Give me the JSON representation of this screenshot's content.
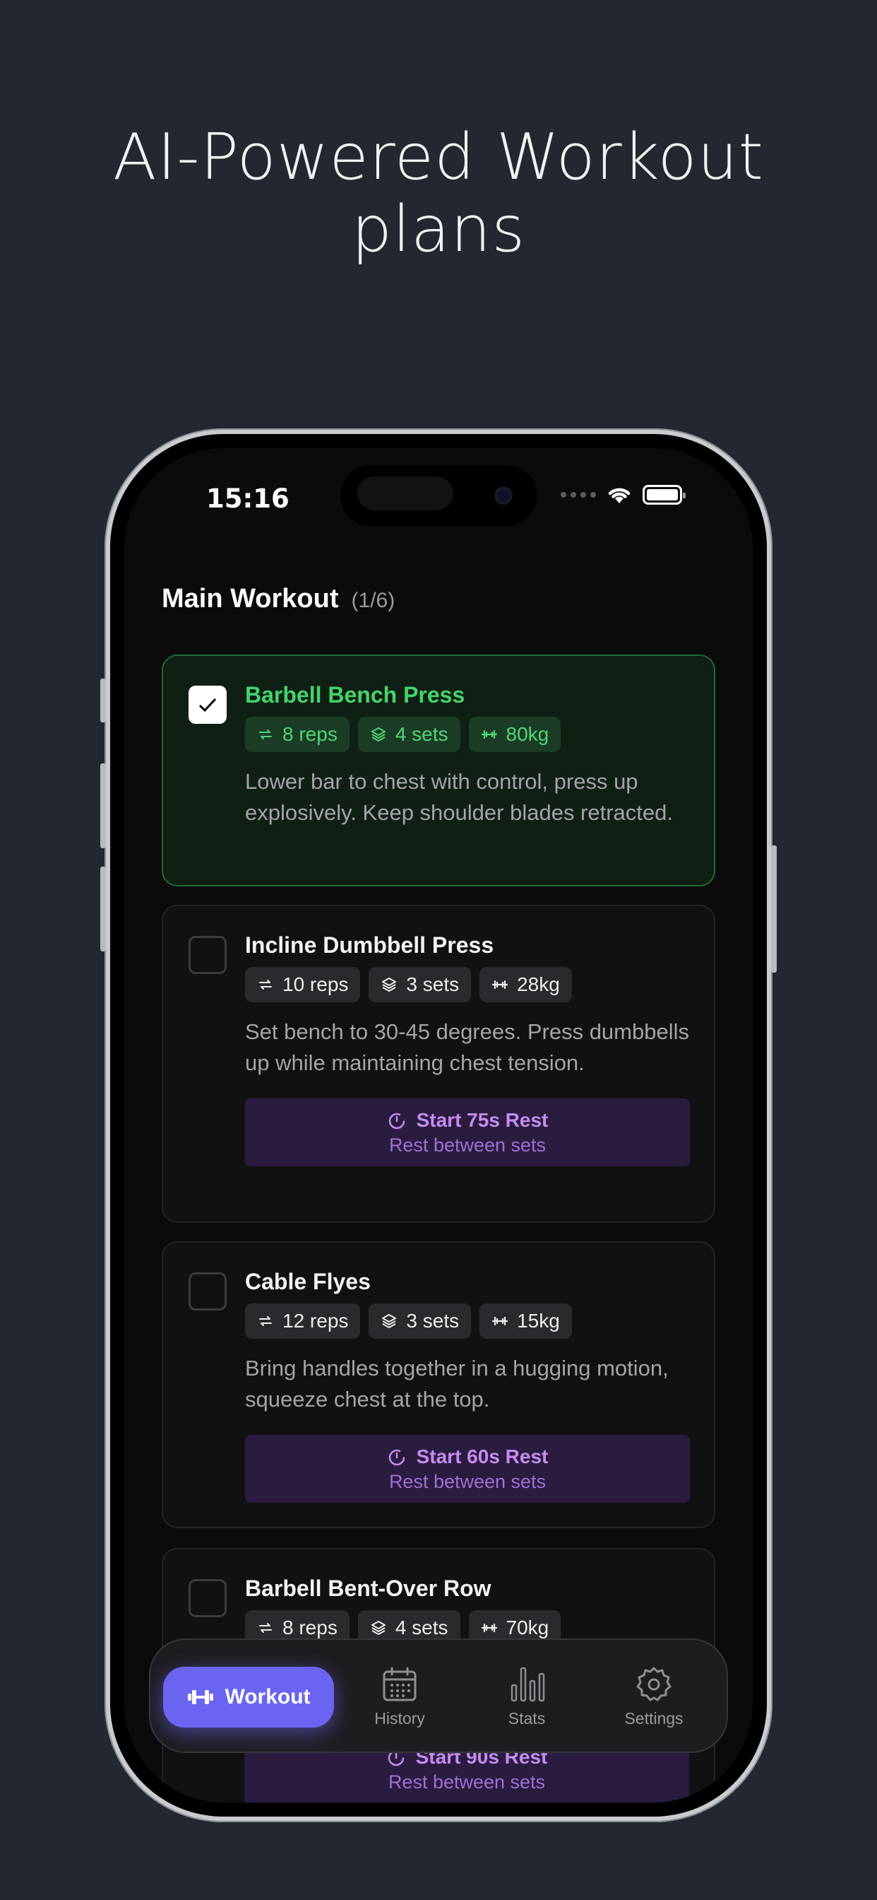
{
  "headline": {
    "line1": "AI-Powered Workout",
    "line2": "plans"
  },
  "status_bar": {
    "time": "15:16"
  },
  "section": {
    "title": "Main Workout",
    "count": "(1/6)"
  },
  "exercises": [
    {
      "name": "Barbell Bench Press",
      "completed": true,
      "reps": "8 reps",
      "sets": "4 sets",
      "weight": "80kg",
      "description": "Lower bar to chest with control, press up explosively. Keep shoulder blades retracted."
    },
    {
      "name": "Incline Dumbbell Press",
      "completed": false,
      "reps": "10 reps",
      "sets": "3 sets",
      "weight": "28kg",
      "description": "Set bench to 30-45 degrees. Press dumbbells up while maintaining chest tension.",
      "rest_button": {
        "label": "Start 75s Rest",
        "sublabel": "Rest between sets"
      }
    },
    {
      "name": "Cable Flyes",
      "completed": false,
      "reps": "12 reps",
      "sets": "3 sets",
      "weight": "15kg",
      "description": "Bring handles together in a hugging motion, squeeze chest at the top.",
      "rest_button": {
        "label": "Start 60s Rest",
        "sublabel": "Rest between sets"
      }
    },
    {
      "name": "Barbell Bent-Over Row",
      "completed": false,
      "reps": "8 reps",
      "sets": "4 sets",
      "weight": "70kg",
      "rest_button": {
        "label": "Start 90s Rest",
        "sublabel": "Rest between sets"
      }
    }
  ],
  "tabbar": {
    "workout": "Workout",
    "history": "History",
    "stats": "Stats",
    "settings": "Settings"
  },
  "colors": {
    "background": "#23272f",
    "accent": "#6a64f1",
    "success": "#45d36b",
    "rest": "#c58cf0"
  },
  "icons": {
    "reps": "repeat-icon",
    "sets": "layers-icon",
    "weight": "dumbbell-icon",
    "rest": "timer-icon",
    "history": "calendar-icon",
    "stats": "bar-chart-icon",
    "settings": "gear-icon"
  }
}
